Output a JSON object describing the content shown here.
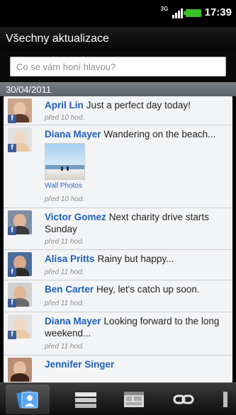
{
  "status_bar": {
    "network": "3G",
    "time": "17:39"
  },
  "header": {
    "title": "Všechny aktualizace"
  },
  "search": {
    "placeholder": "Co se vám honí hlavou?"
  },
  "feed": {
    "date": "30/04/2011",
    "posts": [
      {
        "name": "April Lin",
        "text": "Just a perfect day today!",
        "time": "před 10 hod."
      },
      {
        "name": "Diana Mayer",
        "text": "Wandering on the beach...",
        "photo_label": "Wall Photos",
        "time": "před 10 hod."
      },
      {
        "name": "Victor Gomez",
        "text": "Next charity drive starts Sunday",
        "time": "před 11 hod."
      },
      {
        "name": "Alisa Pritts",
        "text": "Rainy but happy...",
        "time": "před 11 hod."
      },
      {
        "name": "Ben Carter",
        "text": "Hey, let's catch up soon.",
        "time": "před 11 hod."
      },
      {
        "name": "Diana Mayer",
        "text": "Looking forward to the long weekend...",
        "time": "před 11 hod."
      },
      {
        "name": "Jennifer Singer",
        "text": ""
      }
    ]
  },
  "tabs": [
    {
      "icon": "friends-stream-icon"
    },
    {
      "icon": "status-list-icon"
    },
    {
      "icon": "photos-icon"
    },
    {
      "icon": "links-icon"
    },
    {
      "icon": "more-icon"
    }
  ],
  "colors": {
    "name_link": "#1f60b8",
    "facebook": "#3b5b99",
    "battery": "#39c12a"
  }
}
